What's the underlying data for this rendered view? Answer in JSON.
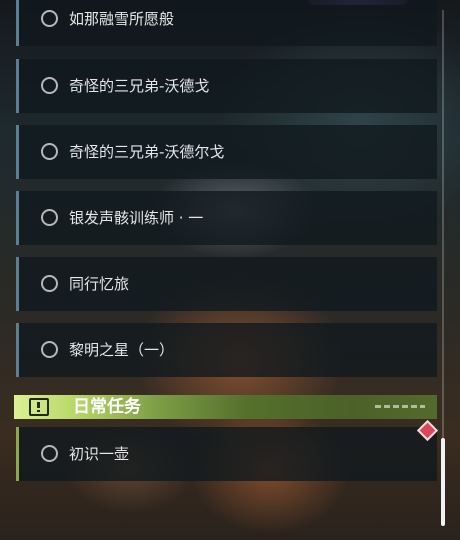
{
  "quests": [
    {
      "title": "如那融雪所愿般"
    },
    {
      "title": "奇怪的三兄弟-沃德戈"
    },
    {
      "title": "奇怪的三兄弟-沃德尔戈"
    },
    {
      "title": "银发声骸训练师 · 一"
    },
    {
      "title": "同行忆旅"
    },
    {
      "title": "黎明之星（一）"
    }
  ],
  "daily_section": {
    "title": "日常任务",
    "icon": "exclamation-icon",
    "quests": [
      {
        "title": "初识一壶",
        "tracked": true
      }
    ]
  },
  "colors": {
    "quest_accent": "#5b7e90",
    "daily_accent": "#8ca84b",
    "tracked_marker": "#d9485a"
  },
  "scroll": {
    "position": 0.85
  }
}
